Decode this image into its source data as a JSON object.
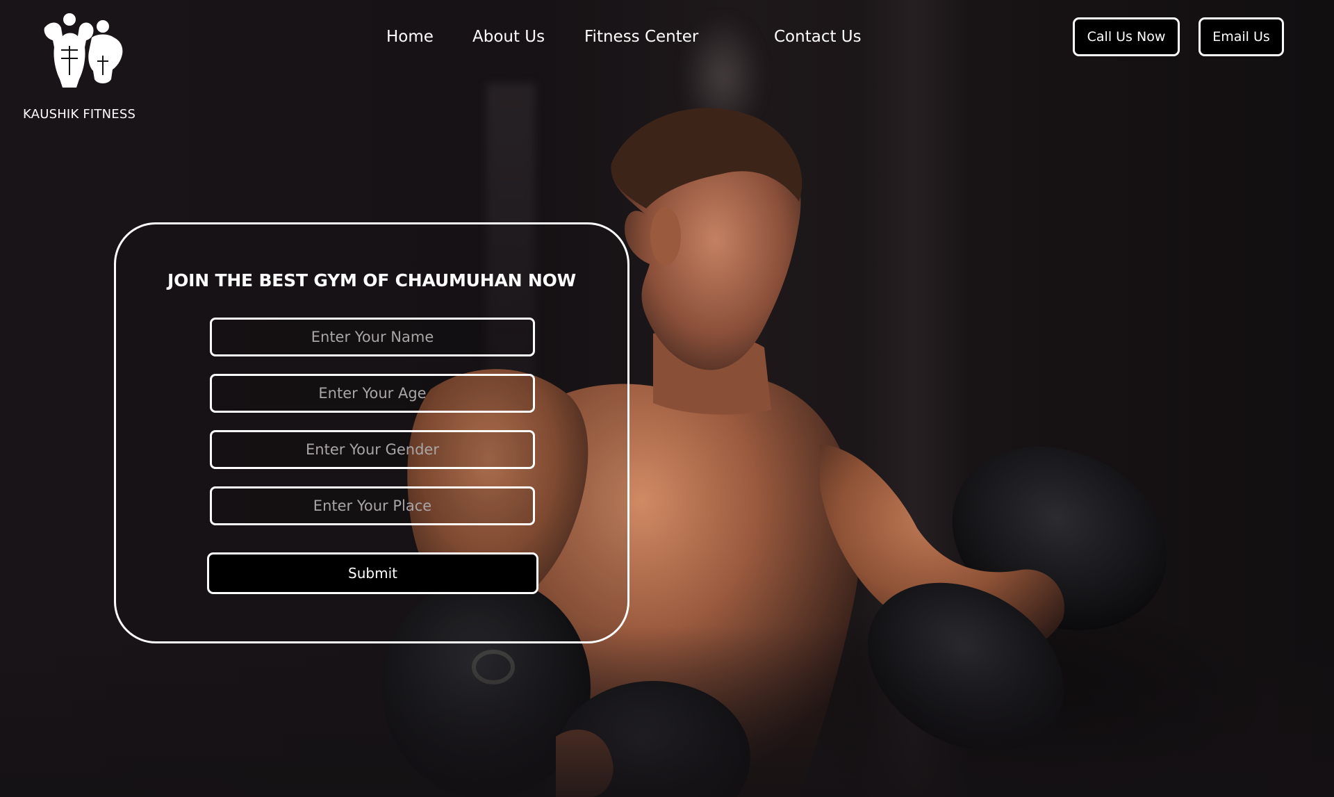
{
  "brand": {
    "name": "KAUSHIK FITNESS",
    "logo_icon": "bodybuilder-couple-logo"
  },
  "nav": {
    "items": [
      {
        "label": "Home"
      },
      {
        "label": "About Us"
      },
      {
        "label": "Fitness Center"
      },
      {
        "label": "Contact Us"
      }
    ]
  },
  "header_actions": {
    "call_label": "Call Us Now",
    "email_label": "Email Us"
  },
  "form": {
    "title": "JOIN THE BEST GYM OF CHAUMUHAN NOW",
    "fields": {
      "name_placeholder": "Enter Your Name",
      "age_placeholder": "Enter Your Age",
      "gender_placeholder": "Enter Your Gender",
      "place_placeholder": "Enter Your Place"
    },
    "submit_label": "Submit"
  },
  "colors": {
    "background": "#141114",
    "text": "#ffffff",
    "button_bg": "#000000",
    "border": "#ffffff",
    "placeholder": "#a9a6a8",
    "skin": "#9a5a3e"
  }
}
